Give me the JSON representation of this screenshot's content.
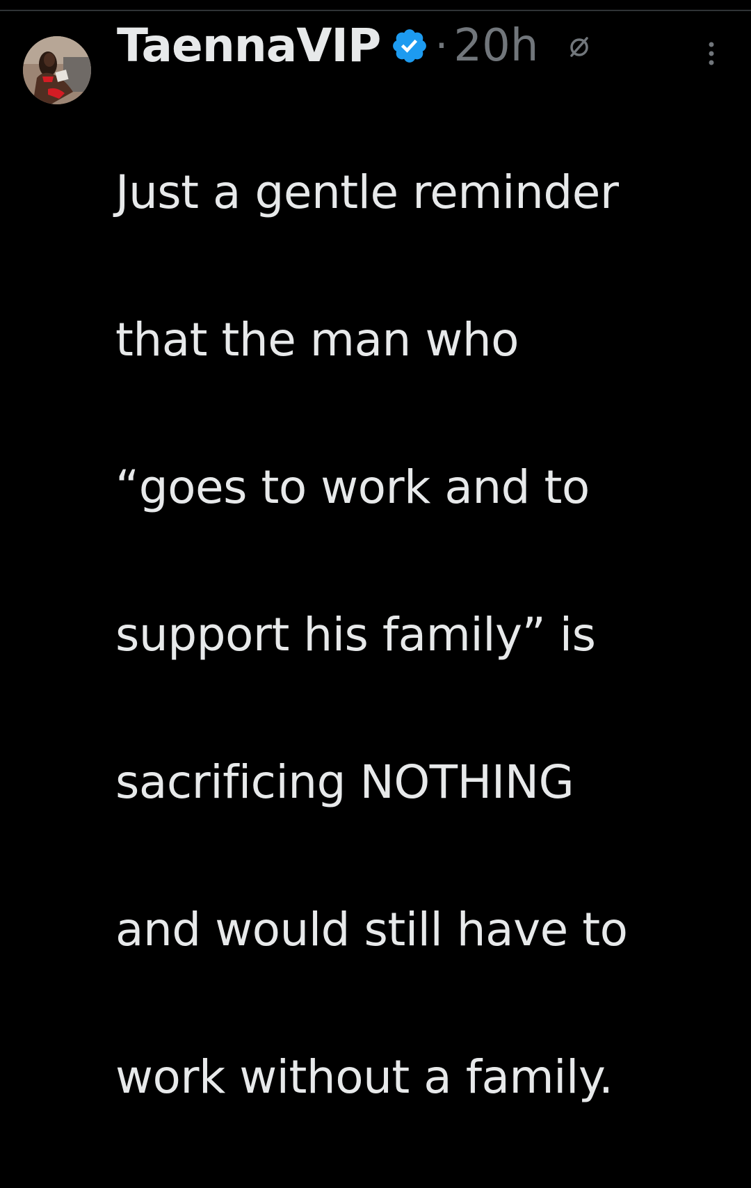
{
  "tweet": {
    "display_name": "TaennaVIP",
    "separator": "·",
    "timestamp": "20h",
    "text_lines": [
      "Just a gentle reminder",
      "that the man who",
      "“goes to work and to",
      "support his family” is",
      "sacrificing NOTHING",
      "and would still have to",
      "work without a family."
    ]
  },
  "icons": {
    "avatar": "user-avatar-photo",
    "verified": "verified-badge-icon",
    "edited": "edited-circle-slash-icon",
    "more": "more-vertical-icon"
  },
  "colors": {
    "background": "#000000",
    "text": "#e7e9ea",
    "muted": "#71767b",
    "verified": "#1d9bf0"
  }
}
